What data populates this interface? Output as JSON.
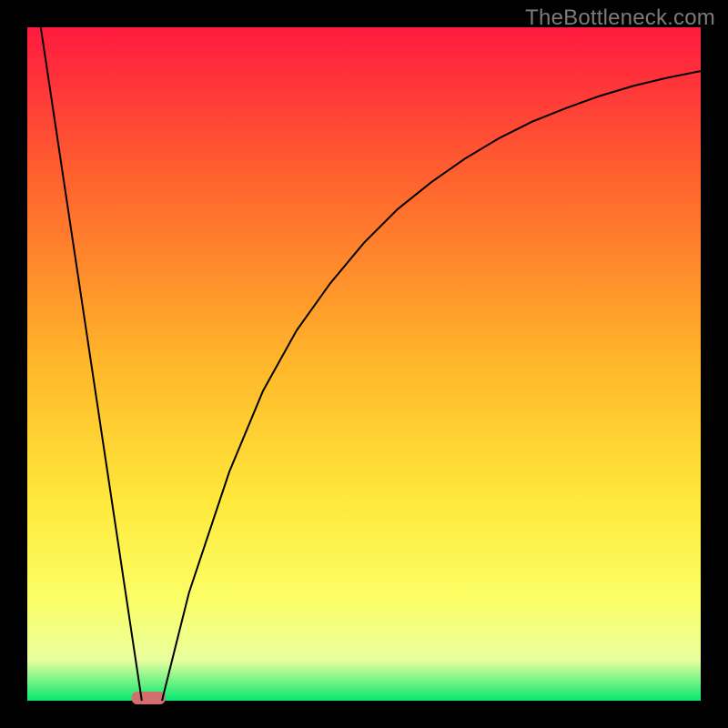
{
  "watermark": "TheBottleneck.com",
  "chart_data": {
    "type": "line",
    "title": "",
    "xlabel": "",
    "ylabel": "",
    "xlim": [
      0,
      100
    ],
    "ylim": [
      0,
      100
    ],
    "series": [
      {
        "name": "left-line",
        "x": [
          2,
          17
        ],
        "y": [
          100,
          0
        ]
      },
      {
        "name": "right-curve",
        "x": [
          20,
          22,
          24,
          26,
          30,
          35,
          40,
          45,
          50,
          55,
          60,
          65,
          70,
          75,
          80,
          85,
          90,
          95,
          100
        ],
        "y": [
          0,
          8,
          16,
          22,
          34,
          46,
          55,
          62,
          68,
          73,
          77,
          80.5,
          83.5,
          86,
          88,
          89.8,
          91.3,
          92.5,
          93.5
        ]
      }
    ],
    "marker": {
      "x_range": [
        15.5,
        20.5
      ],
      "y": 0.4,
      "color": "#d36e6e"
    },
    "gradient_colors": {
      "top": "#ff1a3f",
      "mid1": "#ff6a2d",
      "mid2": "#ffb72a",
      "mid3": "#ffe83a",
      "mid4": "#fbff66",
      "band": "#e8ff9e",
      "bottom": "#07e86f"
    },
    "frame_color": "#000000"
  }
}
